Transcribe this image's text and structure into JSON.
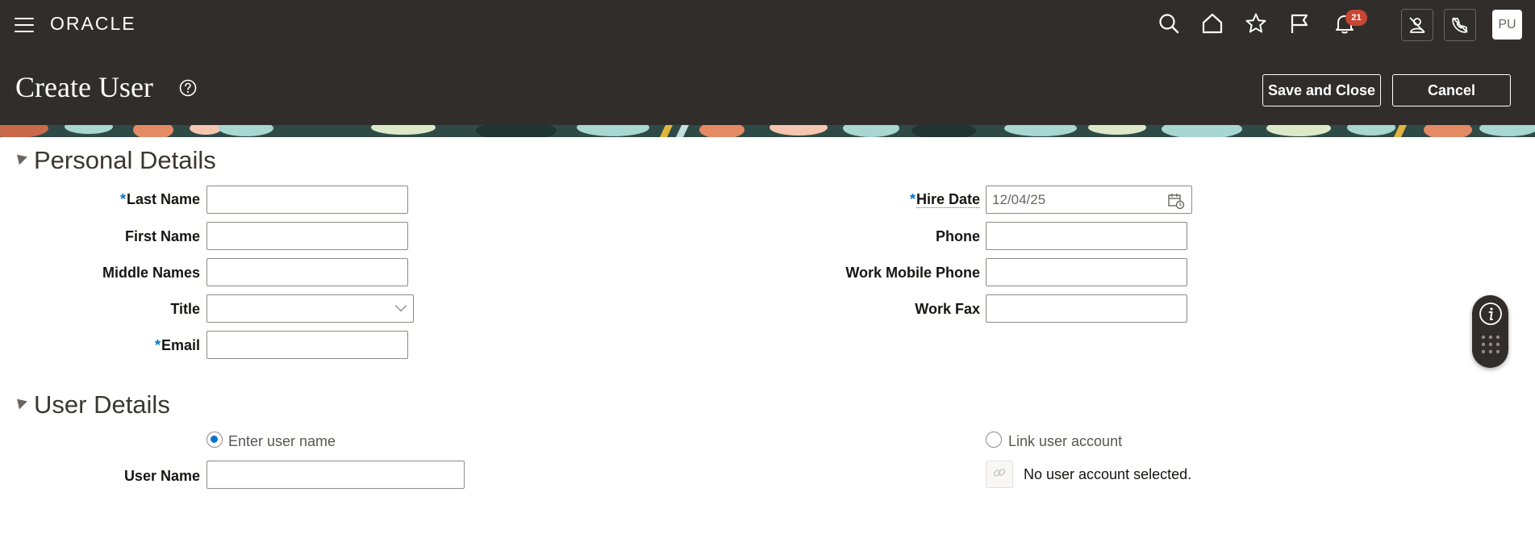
{
  "app": {
    "logo": "ORACLE",
    "notifications_count": "21",
    "avatar_initials": "PU"
  },
  "header": {
    "title": "Create User",
    "save_label": "Save and Close",
    "cancel_label": "Cancel"
  },
  "personal_details": {
    "heading": "Personal Details",
    "last_name_label": "Last Name",
    "first_name_label": "First Name",
    "middle_names_label": "Middle Names",
    "title_label": "Title",
    "email_label": "Email",
    "hire_date_label": "Hire Date",
    "hire_date_value": "12/04/25",
    "phone_label": "Phone",
    "work_mobile_label": "Work Mobile Phone",
    "work_fax_label": "Work Fax",
    "required_marker": "*"
  },
  "user_details": {
    "heading": "User Details",
    "enter_user_name_option": "Enter user name",
    "link_account_option": "Link user account",
    "user_name_label": "User Name",
    "no_account_text": "No user account selected."
  },
  "colors": {
    "header_bg": "#312d2a",
    "required": "#0572ce",
    "badge": "#c74634"
  },
  "icons": [
    "hamburger-icon",
    "search-icon",
    "home-icon",
    "star-icon",
    "flag-icon",
    "bell-icon",
    "no-presence-icon",
    "no-phone-icon",
    "help-icon",
    "calendar-icon",
    "chevron-down-icon",
    "link-icon",
    "info-icon",
    "keypad-icon"
  ]
}
